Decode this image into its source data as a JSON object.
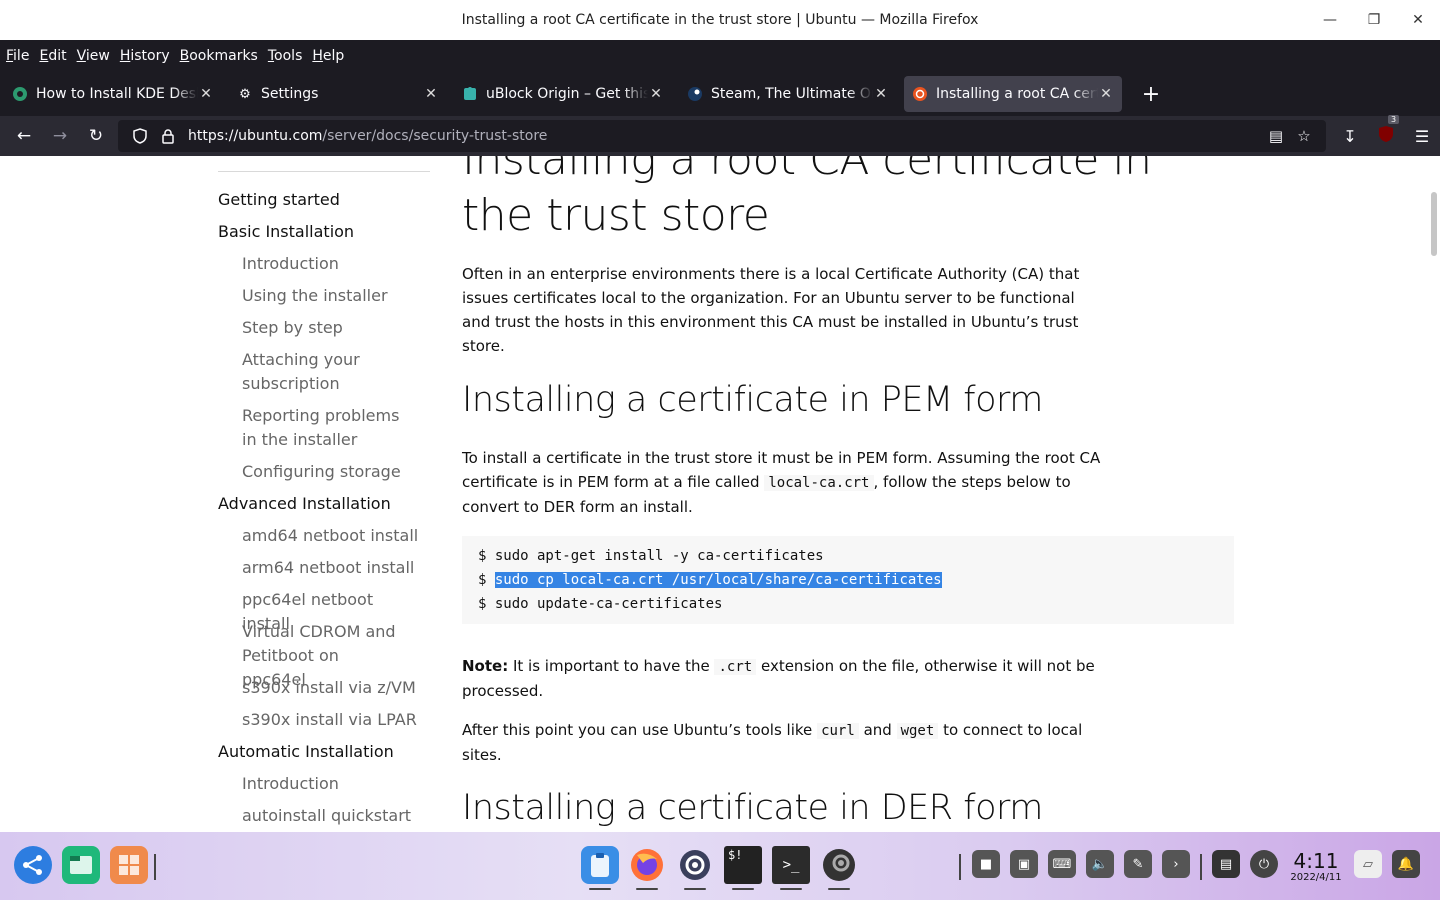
{
  "window": {
    "title": "Installing a root CA certificate in the trust store | Ubuntu — Mozilla Firefox",
    "controls": [
      "minimize",
      "maximize",
      "close"
    ]
  },
  "menu": [
    "File",
    "Edit",
    "View",
    "History",
    "Bookmarks",
    "Tools",
    "Help"
  ],
  "tabs": [
    {
      "label": "How to Install KDE Desktop",
      "icon": "kde-icon",
      "active": false
    },
    {
      "label": "Settings",
      "icon": "gear-icon",
      "active": false
    },
    {
      "label": "uBlock Origin – Get this Extension",
      "icon": "puzzle-icon",
      "active": false
    },
    {
      "label": "Steam, The Ultimate Online Game Platform",
      "icon": "steam-icon",
      "active": false
    },
    {
      "label": "Installing a root CA certificate",
      "icon": "ubuntu-icon",
      "active": true
    }
  ],
  "nav": {
    "url_host": "https://ubuntu.com",
    "url_path": "/server/docs/security-trust-store",
    "ublock_count": "3"
  },
  "sidebar": {
    "items": [
      {
        "label": "Getting started",
        "level": 0
      },
      {
        "label": "Basic Installation",
        "level": 0
      },
      {
        "label": "Introduction",
        "level": 1
      },
      {
        "label": "Using the installer",
        "level": 1
      },
      {
        "label": "Step by step",
        "level": 1
      },
      {
        "label": "Attaching your subscription",
        "level": 1
      },
      {
        "label": "Reporting problems in the installer",
        "level": 1
      },
      {
        "label": "Configuring storage",
        "level": 1
      },
      {
        "label": "Advanced Installation",
        "level": 0
      },
      {
        "label": "amd64 netboot install",
        "level": 1
      },
      {
        "label": "arm64 netboot install",
        "level": 1
      },
      {
        "label": "ppc64el netboot install",
        "level": 1
      },
      {
        "label": "Virtual CDROM and Petitboot on ppc64el",
        "level": 1
      },
      {
        "label": "s390x install via z/VM",
        "level": 1
      },
      {
        "label": "s390x install via LPAR",
        "level": 1
      },
      {
        "label": "Automatic Installation",
        "level": 0
      },
      {
        "label": "Introduction",
        "level": 1
      },
      {
        "label": "autoinstall quickstart",
        "level": 1
      }
    ]
  },
  "article": {
    "title": "Installing a root CA certificate in the trust store",
    "intro": "Often in an enterprise environments there is a local Certificate Authority (CA) that issues certificates local to the organization. For an Ubuntu server to be functional and trust the hosts in this environment this CA must be installed in Ubuntu’s trust store.",
    "h2_pem": "Installing a certificate in PEM form",
    "pem_p1": "To install a certificate in the trust store it must be in PEM form. Assuming the root CA certificate is in PEM form at a file called",
    "pem_code": "local-ca.crt",
    "pem_p2": ", follow the steps below to convert to DER form an install.",
    "code_lines": [
      {
        "prompt": "$ ",
        "cmd": "sudo apt-get install -y ca-certificates",
        "selected": false
      },
      {
        "prompt": "$ ",
        "cmd": "sudo cp local-ca.crt /usr/local/share/ca-certificates",
        "selected": true
      },
      {
        "prompt": "$ ",
        "cmd": "sudo update-ca-certificates",
        "selected": false
      }
    ],
    "note_label": "Note:",
    "note_p1": "It is important to have the",
    "note_code": ".crt",
    "note_p2": "extension on the file, otherwise it will not be processed.",
    "after_p1": "After this point you can use Ubuntu’s tools like",
    "after_code1": "curl",
    "after_and": "and",
    "after_code2": "wget",
    "after_p2": "to connect to local sites.",
    "h2_der": "Installing a certificate in DER form"
  },
  "taskbar": {
    "time": "4:11",
    "date": "2022/4/11"
  }
}
